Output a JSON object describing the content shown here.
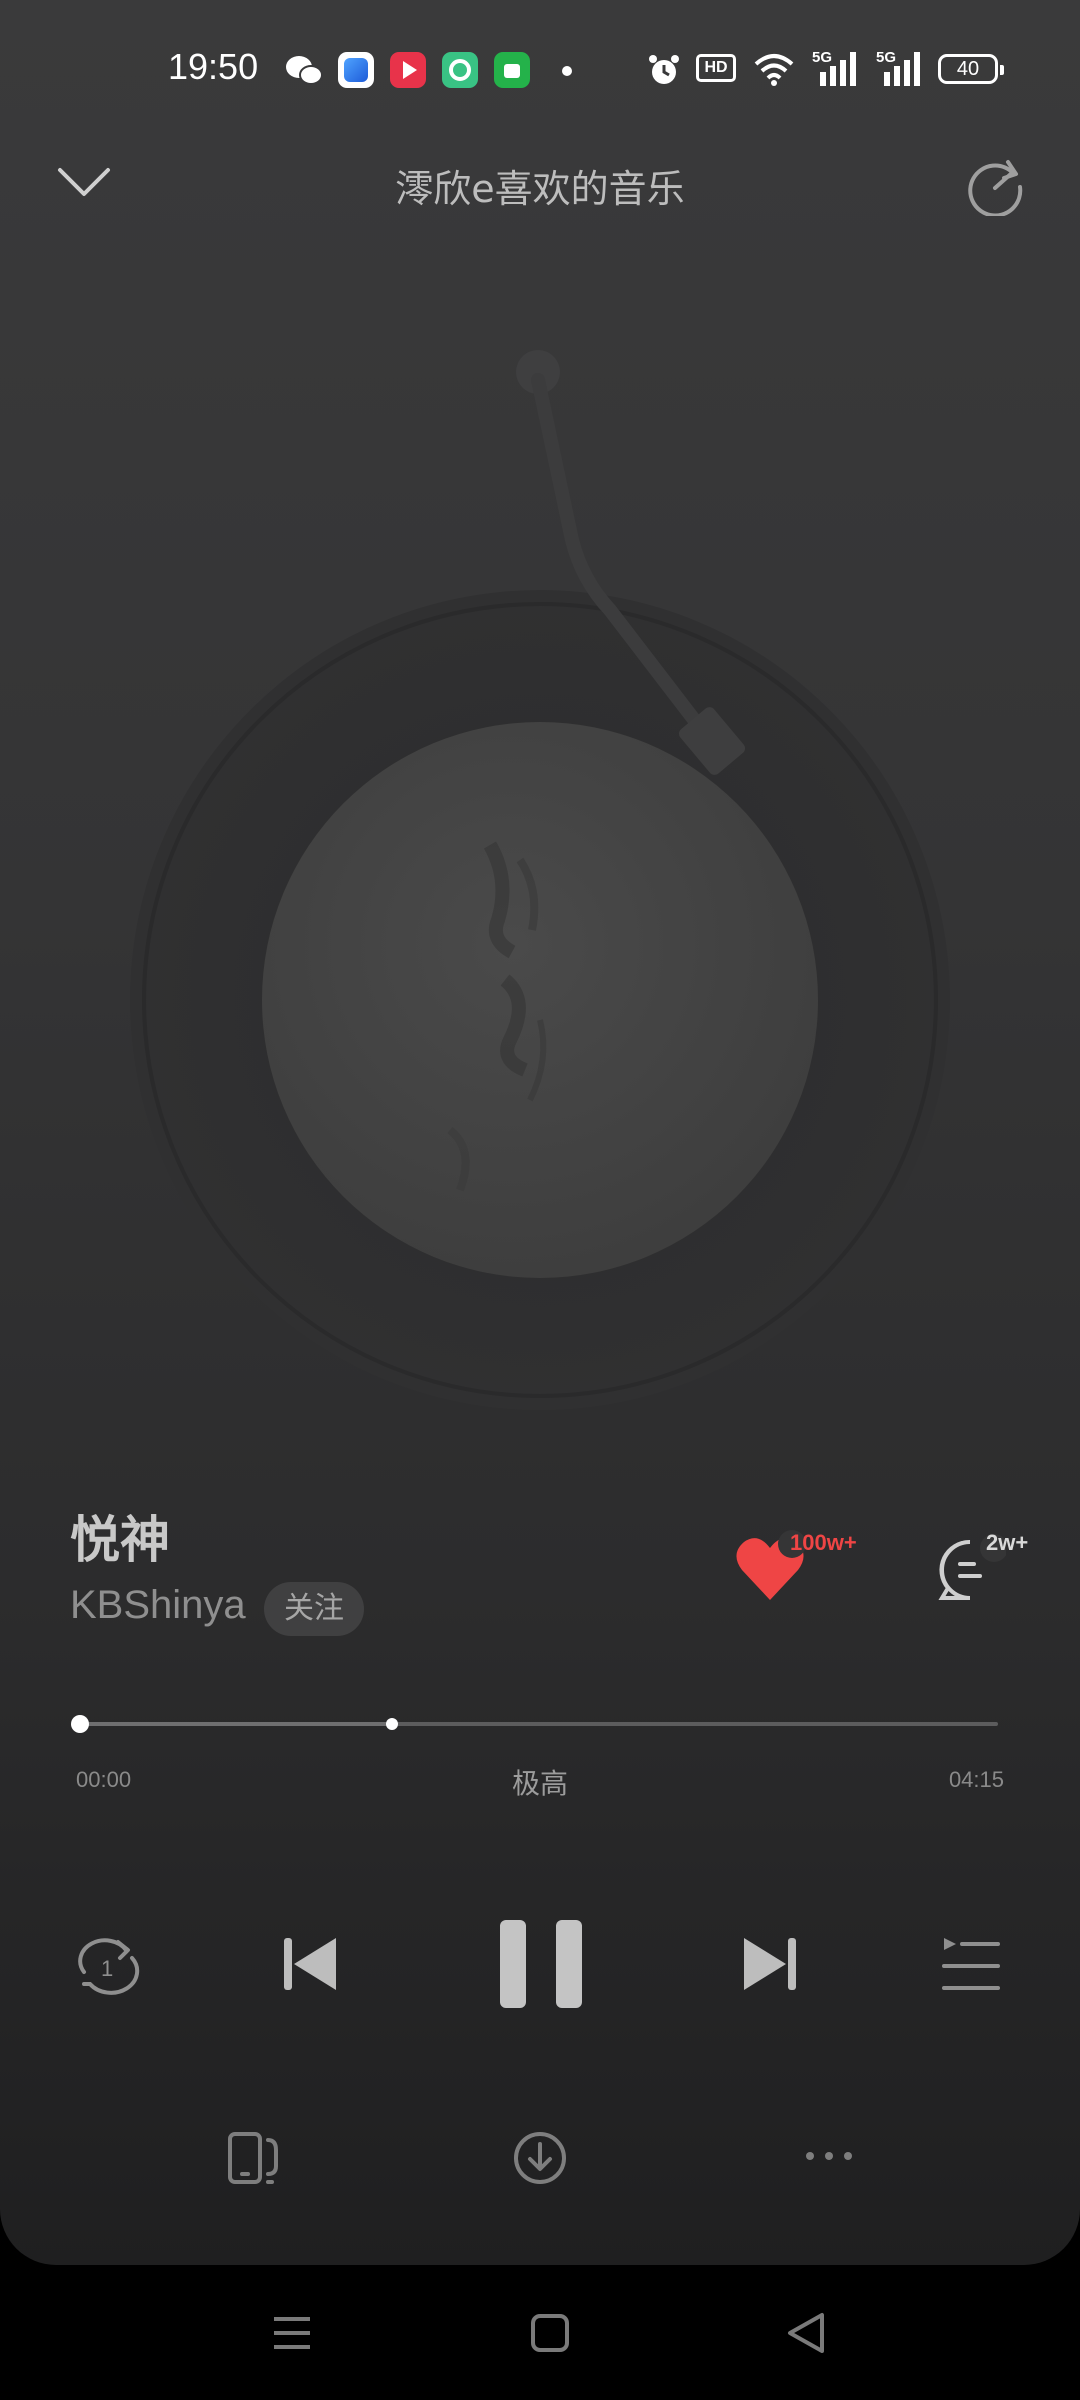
{
  "status_bar": {
    "time": "19:50",
    "icons": [
      "wechat-icon",
      "app-blue-icon",
      "video-red-icon",
      "app-green-icon",
      "app-store-icon",
      "dot-icon",
      "alarm-icon",
      "hd-icon",
      "wifi-icon",
      "signal-5g-icon",
      "signal-5g-icon"
    ],
    "battery": "40"
  },
  "header": {
    "title": "澪欣e喜欢的音乐",
    "left_icon": "chevron-down-icon",
    "right_icon": "share-icon"
  },
  "song": {
    "title": "悦神",
    "artist": "KBShinya",
    "follow_label": "关注"
  },
  "actions": {
    "like_count": "100w+",
    "comment_count": "2w+"
  },
  "progress": {
    "current": "00:00",
    "total": "04:15",
    "quality": "极高",
    "position_fraction": 0,
    "buffered_fraction": 0.34
  },
  "controls": [
    "repeat-one-icon",
    "previous-icon",
    "pause-icon",
    "next-icon",
    "playlist-icon"
  ],
  "bottom_actions": [
    "device-icon",
    "download-icon",
    "more-icon"
  ],
  "colors": {
    "accent_red": "#ef4545",
    "background": "#353536"
  }
}
